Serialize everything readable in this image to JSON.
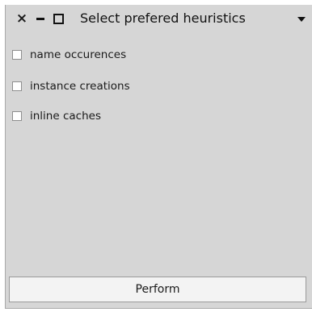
{
  "window": {
    "title": "Select prefered heuristics",
    "controls": {
      "close_icon": "close-icon",
      "minimize_icon": "minimize-icon",
      "maximize_icon": "maximize-icon",
      "menu_icon": "chevron-down-icon"
    }
  },
  "options": [
    {
      "label": "name occurences",
      "checked": false
    },
    {
      "label": "instance creations",
      "checked": false
    },
    {
      "label": "inline caches",
      "checked": false
    }
  ],
  "actions": {
    "perform_label": "Perform"
  }
}
